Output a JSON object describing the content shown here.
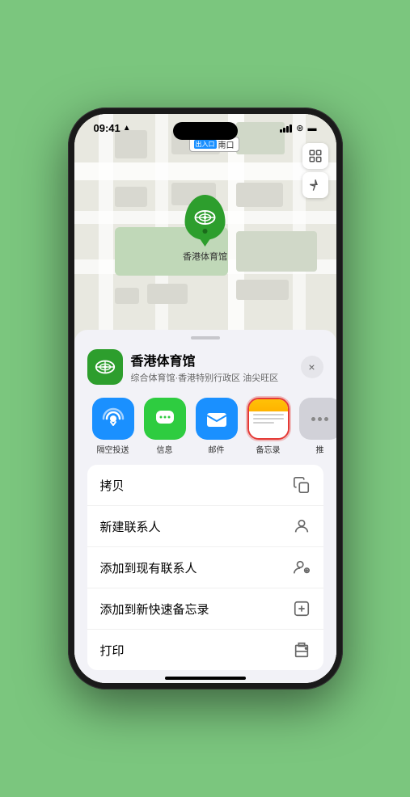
{
  "statusBar": {
    "time": "09:41",
    "locationArrow": "▲"
  },
  "map": {
    "label": "南口",
    "labelPrefix": "出入口"
  },
  "venue": {
    "name": "香港体育馆",
    "subtitle": "综合体育馆·香港特别行政区 油尖旺区",
    "pinLabel": "香港体育馆"
  },
  "shareActions": [
    {
      "id": "airdrop",
      "label": "隔空投送",
      "type": "airdrop"
    },
    {
      "id": "messages",
      "label": "信息",
      "type": "messages"
    },
    {
      "id": "mail",
      "label": "邮件",
      "type": "mail"
    },
    {
      "id": "notes",
      "label": "备忘录",
      "type": "notes"
    },
    {
      "id": "more",
      "label": "推",
      "type": "more"
    }
  ],
  "menuItems": [
    {
      "id": "copy",
      "label": "拷贝",
      "icon": "copy"
    },
    {
      "id": "new-contact",
      "label": "新建联系人",
      "icon": "person"
    },
    {
      "id": "add-contact",
      "label": "添加到现有联系人",
      "icon": "person-add"
    },
    {
      "id": "add-notes",
      "label": "添加到新快速备忘录",
      "icon": "notes"
    },
    {
      "id": "print",
      "label": "打印",
      "icon": "print"
    }
  ],
  "buttons": {
    "close": "×"
  }
}
